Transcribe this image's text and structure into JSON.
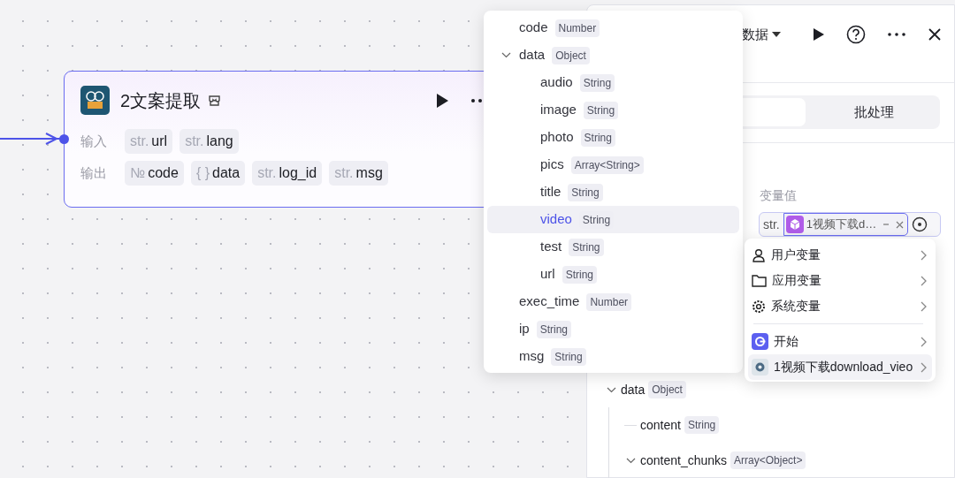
{
  "node": {
    "title": "2文案提取",
    "inputs_label": "输入",
    "inputs": [
      {
        "type": "str.",
        "name": "url"
      },
      {
        "type": "str.",
        "name": "lang"
      }
    ],
    "outputs_label": "输出",
    "outputs": [
      {
        "type": "№",
        "name": "code"
      },
      {
        "type": "{ }",
        "name": "data"
      },
      {
        "type": "str.",
        "name": "log_id"
      },
      {
        "type": "str.",
        "name": "msg"
      }
    ]
  },
  "panel": {
    "title": "数据",
    "tabs": [
      {
        "selected": true
      },
      {
        "label": "批处理",
        "selected": false
      }
    ],
    "variable": {
      "label": "变量值",
      "type": "str.",
      "value": "1视频下载d…"
    },
    "output_tree": [
      {
        "name": "data",
        "type": "Object",
        "expanded": true,
        "children": [
          {
            "name": "content",
            "type": "String"
          },
          {
            "name": "content_chunks",
            "type": "Array<Object>",
            "expanded": true
          }
        ]
      }
    ]
  },
  "dropdown": {
    "items": [
      {
        "name": "code",
        "type": "Number",
        "selected": false
      },
      {
        "name": "data",
        "type": "Object",
        "expanded": true,
        "selected": false,
        "children": [
          {
            "name": "audio",
            "type": "String",
            "selected": false
          },
          {
            "name": "image",
            "type": "String",
            "selected": false
          },
          {
            "name": "photo",
            "type": "String",
            "selected": false
          },
          {
            "name": "pics",
            "type": "Array<String>",
            "selected": false
          },
          {
            "name": "title",
            "type": "String",
            "selected": false
          },
          {
            "name": "video",
            "type": "String",
            "selected": true
          },
          {
            "name": "test",
            "type": "String",
            "selected": false
          },
          {
            "name": "url",
            "type": "String",
            "selected": false
          }
        ]
      },
      {
        "name": "exec_time",
        "type": "Number",
        "selected": false
      },
      {
        "name": "ip",
        "type": "String",
        "selected": false
      },
      {
        "name": "msg",
        "type": "String",
        "selected": false
      }
    ]
  },
  "submenu": {
    "items": [
      {
        "kind": "user",
        "label": "用户变量",
        "selected": false
      },
      {
        "kind": "app",
        "label": "应用变量",
        "selected": false
      },
      {
        "kind": "system",
        "label": "系统变量",
        "selected": false
      },
      {
        "kind": "start",
        "label": "开始",
        "selected": false
      },
      {
        "kind": "node",
        "label": "1视频下载download_vieo",
        "selected": true
      }
    ]
  }
}
